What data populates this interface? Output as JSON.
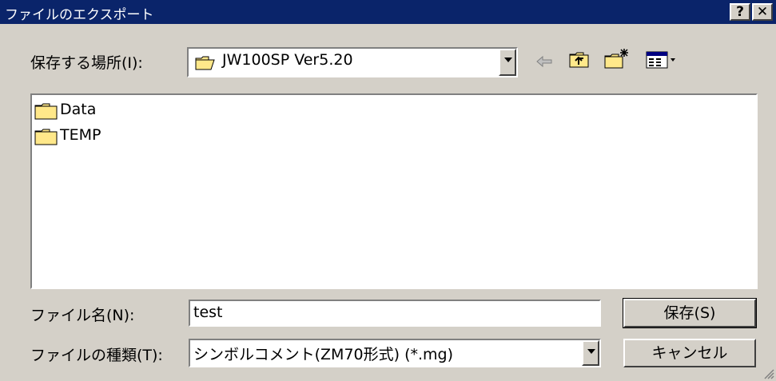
{
  "window": {
    "title": "ファイルのエクスポート",
    "help_btn": "?",
    "close_btn": "✕"
  },
  "location": {
    "label": "保存する場所(I):",
    "value": "JW100SP Ver5.20"
  },
  "toolbar": {
    "back": "back-arrow-icon",
    "up": "up-folder-icon",
    "new_folder": "new-folder-icon",
    "view": "view-menu-icon"
  },
  "files": [
    {
      "name": "Data",
      "icon": "folder-icon"
    },
    {
      "name": "TEMP",
      "icon": "folder-icon"
    }
  ],
  "filename": {
    "label": "ファイル名(N):",
    "value": "test"
  },
  "filetype": {
    "label": "ファイルの種類(T):",
    "value": "シンボルコメント(ZM70形式) (*.mg)"
  },
  "buttons": {
    "save": "保存(S)",
    "cancel": "キャンセル"
  },
  "colors": {
    "titlebar": "#0a246a",
    "face": "#d4d0c8",
    "folder": "#ffe88a"
  }
}
